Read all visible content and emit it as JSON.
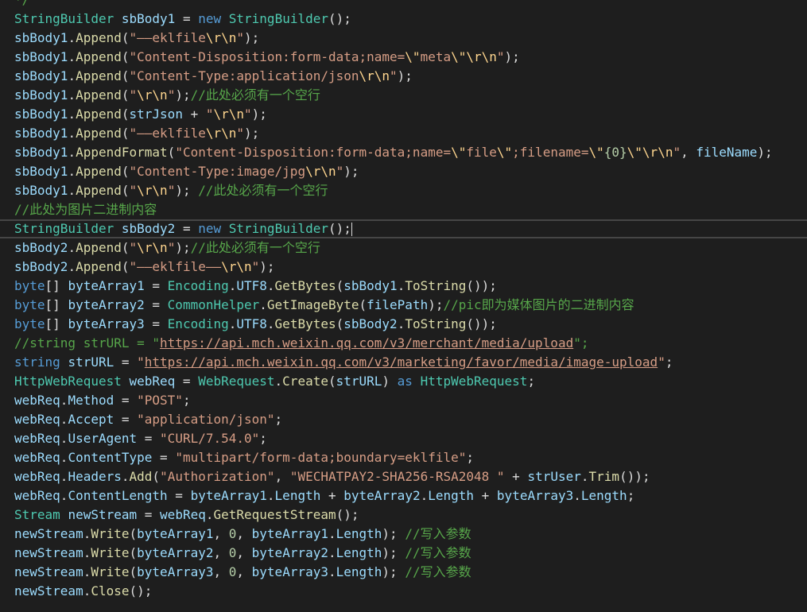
{
  "colors": {
    "background": "#1e1e1e",
    "plain": "#dcdcdc",
    "type": "#4ec9b0",
    "keyword": "#569cd6",
    "variable": "#9cdcfe",
    "string": "#d69d85",
    "escape": "#ffd68f",
    "comment": "#57a64a",
    "method": "#dcdcaa",
    "number": "#b5cea8"
  },
  "editor": {
    "current_line_index": 12,
    "lines": [
      [
        [
          "comment",
          "*/"
        ]
      ],
      [
        [
          "type",
          "StringBuilder"
        ],
        [
          "plain",
          " "
        ],
        [
          "var",
          "sbBody1"
        ],
        [
          "plain",
          " = "
        ],
        [
          "keyword",
          "new"
        ],
        [
          "plain",
          " "
        ],
        [
          "type",
          "StringBuilder"
        ],
        [
          "plain",
          "();"
        ]
      ],
      [
        [
          "var",
          "sbBody1"
        ],
        [
          "plain",
          "."
        ],
        [
          "method",
          "Append"
        ],
        [
          "plain",
          "("
        ],
        [
          "string",
          "\"——eklfile"
        ],
        [
          "escape",
          "\\r\\n"
        ],
        [
          "string",
          "\""
        ],
        [
          "plain",
          ");"
        ]
      ],
      [
        [
          "var",
          "sbBody1"
        ],
        [
          "plain",
          "."
        ],
        [
          "method",
          "Append"
        ],
        [
          "plain",
          "("
        ],
        [
          "string",
          "\"Content-Disposition:form-data;name="
        ],
        [
          "escape",
          "\\\""
        ],
        [
          "string",
          "meta"
        ],
        [
          "escape",
          "\\\"\\r\\n"
        ],
        [
          "string",
          "\""
        ],
        [
          "plain",
          ");"
        ]
      ],
      [
        [
          "var",
          "sbBody1"
        ],
        [
          "plain",
          "."
        ],
        [
          "method",
          "Append"
        ],
        [
          "plain",
          "("
        ],
        [
          "string",
          "\"Content-Type:application/json"
        ],
        [
          "escape",
          "\\r\\n"
        ],
        [
          "string",
          "\""
        ],
        [
          "plain",
          ");"
        ]
      ],
      [
        [
          "var",
          "sbBody1"
        ],
        [
          "plain",
          "."
        ],
        [
          "method",
          "Append"
        ],
        [
          "plain",
          "("
        ],
        [
          "string",
          "\""
        ],
        [
          "escape",
          "\\r\\n"
        ],
        [
          "string",
          "\""
        ],
        [
          "plain",
          ");"
        ],
        [
          "comment",
          "//此处必须有一个空行"
        ]
      ],
      [
        [
          "var",
          "sbBody1"
        ],
        [
          "plain",
          "."
        ],
        [
          "method",
          "Append"
        ],
        [
          "plain",
          "("
        ],
        [
          "var",
          "strJson"
        ],
        [
          "plain",
          " + "
        ],
        [
          "string",
          "\""
        ],
        [
          "escape",
          "\\r\\n"
        ],
        [
          "string",
          "\""
        ],
        [
          "plain",
          ");"
        ]
      ],
      [
        [
          "var",
          "sbBody1"
        ],
        [
          "plain",
          "."
        ],
        [
          "method",
          "Append"
        ],
        [
          "plain",
          "("
        ],
        [
          "string",
          "\"——eklfile"
        ],
        [
          "escape",
          "\\r\\n"
        ],
        [
          "string",
          "\""
        ],
        [
          "plain",
          ");"
        ]
      ],
      [
        [
          "var",
          "sbBody1"
        ],
        [
          "plain",
          "."
        ],
        [
          "method",
          "AppendFormat"
        ],
        [
          "plain",
          "("
        ],
        [
          "string",
          "\"Content-Disposition:form-data;name="
        ],
        [
          "escape",
          "\\\""
        ],
        [
          "string",
          "file"
        ],
        [
          "escape",
          "\\\""
        ],
        [
          "string",
          ";filename="
        ],
        [
          "escape",
          "\\\""
        ],
        [
          "number",
          "{0}"
        ],
        [
          "escape",
          "\\\"\\r\\n"
        ],
        [
          "string",
          "\""
        ],
        [
          "plain",
          ", "
        ],
        [
          "var",
          "fileName"
        ],
        [
          "plain",
          ");"
        ]
      ],
      [
        [
          "var",
          "sbBody1"
        ],
        [
          "plain",
          "."
        ],
        [
          "method",
          "Append"
        ],
        [
          "plain",
          "("
        ],
        [
          "string",
          "\"Content-Type:image/jpg"
        ],
        [
          "escape",
          "\\r\\n"
        ],
        [
          "string",
          "\""
        ],
        [
          "plain",
          ");"
        ]
      ],
      [
        [
          "var",
          "sbBody1"
        ],
        [
          "plain",
          "."
        ],
        [
          "method",
          "Append"
        ],
        [
          "plain",
          "("
        ],
        [
          "string",
          "\""
        ],
        [
          "escape",
          "\\r\\n"
        ],
        [
          "string",
          "\""
        ],
        [
          "plain",
          "); "
        ],
        [
          "comment",
          "//此处必须有一个空行"
        ]
      ],
      [
        [
          "comment",
          "//此处为图片二进制内容"
        ]
      ],
      [
        [
          "type",
          "StringBuilder"
        ],
        [
          "plain",
          " "
        ],
        [
          "var",
          "sbBody2"
        ],
        [
          "plain",
          " = "
        ],
        [
          "keyword",
          "new"
        ],
        [
          "plain",
          " "
        ],
        [
          "type",
          "StringBuilder"
        ],
        [
          "plain",
          "();"
        ]
      ],
      [
        [
          "var",
          "sbBody2"
        ],
        [
          "plain",
          "."
        ],
        [
          "method",
          "Append"
        ],
        [
          "plain",
          "("
        ],
        [
          "string",
          "\""
        ],
        [
          "escape",
          "\\r\\n"
        ],
        [
          "string",
          "\""
        ],
        [
          "plain",
          ");"
        ],
        [
          "comment",
          "//此处必须有一个空行"
        ]
      ],
      [
        [
          "var",
          "sbBody2"
        ],
        [
          "plain",
          "."
        ],
        [
          "method",
          "Append"
        ],
        [
          "plain",
          "("
        ],
        [
          "string",
          "\"——eklfile——"
        ],
        [
          "escape",
          "\\r\\n"
        ],
        [
          "string",
          "\""
        ],
        [
          "plain",
          ");"
        ]
      ],
      [
        [
          "keyword",
          "byte"
        ],
        [
          "plain",
          "[] "
        ],
        [
          "var",
          "byteArray1"
        ],
        [
          "plain",
          " = "
        ],
        [
          "type",
          "Encoding"
        ],
        [
          "plain",
          "."
        ],
        [
          "var",
          "UTF8"
        ],
        [
          "plain",
          "."
        ],
        [
          "method",
          "GetBytes"
        ],
        [
          "plain",
          "("
        ],
        [
          "var",
          "sbBody1"
        ],
        [
          "plain",
          "."
        ],
        [
          "method",
          "ToString"
        ],
        [
          "plain",
          "());"
        ]
      ],
      [
        [
          "keyword",
          "byte"
        ],
        [
          "plain",
          "[] "
        ],
        [
          "var",
          "byteArray2"
        ],
        [
          "plain",
          " = "
        ],
        [
          "type",
          "CommonHelper"
        ],
        [
          "plain",
          "."
        ],
        [
          "method",
          "GetImageByte"
        ],
        [
          "plain",
          "("
        ],
        [
          "var",
          "filePath"
        ],
        [
          "plain",
          ");"
        ],
        [
          "comment",
          "//pic即为媒体图片的二进制内容"
        ]
      ],
      [
        [
          "keyword",
          "byte"
        ],
        [
          "plain",
          "[] "
        ],
        [
          "var",
          "byteArray3"
        ],
        [
          "plain",
          " = "
        ],
        [
          "type",
          "Encoding"
        ],
        [
          "plain",
          "."
        ],
        [
          "var",
          "UTF8"
        ],
        [
          "plain",
          "."
        ],
        [
          "method",
          "GetBytes"
        ],
        [
          "plain",
          "("
        ],
        [
          "var",
          "sbBody2"
        ],
        [
          "plain",
          "."
        ],
        [
          "method",
          "ToString"
        ],
        [
          "plain",
          "());"
        ]
      ],
      [
        [
          "comment",
          "//string strURL = \""
        ],
        [
          "link",
          "https://api.mch.weixin.qq.com/v3/merchant/media/upload"
        ],
        [
          "comment",
          "\";"
        ]
      ],
      [
        [
          "keyword",
          "string"
        ],
        [
          "plain",
          " "
        ],
        [
          "var",
          "strURL"
        ],
        [
          "plain",
          " = "
        ],
        [
          "string",
          "\""
        ],
        [
          "link",
          "https://api.mch.weixin.qq.com/v3/marketing/favor/media/image-upload"
        ],
        [
          "string",
          "\""
        ],
        [
          "plain",
          ";"
        ]
      ],
      [
        [
          "type",
          "HttpWebRequest"
        ],
        [
          "plain",
          " "
        ],
        [
          "var",
          "webReq"
        ],
        [
          "plain",
          " = "
        ],
        [
          "type",
          "WebRequest"
        ],
        [
          "plain",
          "."
        ],
        [
          "method",
          "Create"
        ],
        [
          "plain",
          "("
        ],
        [
          "var",
          "strURL"
        ],
        [
          "plain",
          ") "
        ],
        [
          "keyword",
          "as"
        ],
        [
          "plain",
          " "
        ],
        [
          "type",
          "HttpWebRequest"
        ],
        [
          "plain",
          ";"
        ]
      ],
      [
        [
          "var",
          "webReq"
        ],
        [
          "plain",
          "."
        ],
        [
          "var",
          "Method"
        ],
        [
          "plain",
          " = "
        ],
        [
          "string",
          "\"POST\""
        ],
        [
          "plain",
          ";"
        ]
      ],
      [
        [
          "var",
          "webReq"
        ],
        [
          "plain",
          "."
        ],
        [
          "var",
          "Accept"
        ],
        [
          "plain",
          " = "
        ],
        [
          "string",
          "\"application/json\""
        ],
        [
          "plain",
          ";"
        ]
      ],
      [
        [
          "var",
          "webReq"
        ],
        [
          "plain",
          "."
        ],
        [
          "var",
          "UserAgent"
        ],
        [
          "plain",
          " = "
        ],
        [
          "string",
          "\"CURL/7.54.0\""
        ],
        [
          "plain",
          ";"
        ]
      ],
      [
        [
          "var",
          "webReq"
        ],
        [
          "plain",
          "."
        ],
        [
          "var",
          "ContentType"
        ],
        [
          "plain",
          " = "
        ],
        [
          "string",
          "\"multipart/form-data;boundary=eklfile\""
        ],
        [
          "plain",
          ";"
        ]
      ],
      [
        [
          "var",
          "webReq"
        ],
        [
          "plain",
          "."
        ],
        [
          "var",
          "Headers"
        ],
        [
          "plain",
          "."
        ],
        [
          "method",
          "Add"
        ],
        [
          "plain",
          "("
        ],
        [
          "string",
          "\"Authorization\""
        ],
        [
          "plain",
          ", "
        ],
        [
          "string",
          "\"WECHATPAY2-SHA256-RSA2048 \""
        ],
        [
          "plain",
          " + "
        ],
        [
          "var",
          "strUser"
        ],
        [
          "plain",
          "."
        ],
        [
          "method",
          "Trim"
        ],
        [
          "plain",
          "());"
        ]
      ],
      [
        [
          "var",
          "webReq"
        ],
        [
          "plain",
          "."
        ],
        [
          "var",
          "ContentLength"
        ],
        [
          "plain",
          " = "
        ],
        [
          "var",
          "byteArray1"
        ],
        [
          "plain",
          "."
        ],
        [
          "var",
          "Length"
        ],
        [
          "plain",
          " + "
        ],
        [
          "var",
          "byteArray2"
        ],
        [
          "plain",
          "."
        ],
        [
          "var",
          "Length"
        ],
        [
          "plain",
          " + "
        ],
        [
          "var",
          "byteArray3"
        ],
        [
          "plain",
          "."
        ],
        [
          "var",
          "Length"
        ],
        [
          "plain",
          ";"
        ]
      ],
      [
        [
          "type",
          "Stream"
        ],
        [
          "plain",
          " "
        ],
        [
          "var",
          "newStream"
        ],
        [
          "plain",
          " = "
        ],
        [
          "var",
          "webReq"
        ],
        [
          "plain",
          "."
        ],
        [
          "method",
          "GetRequestStream"
        ],
        [
          "plain",
          "();"
        ]
      ],
      [
        [
          "var",
          "newStream"
        ],
        [
          "plain",
          "."
        ],
        [
          "method",
          "Write"
        ],
        [
          "plain",
          "("
        ],
        [
          "var",
          "byteArray1"
        ],
        [
          "plain",
          ", "
        ],
        [
          "number",
          "0"
        ],
        [
          "plain",
          ", "
        ],
        [
          "var",
          "byteArray1"
        ],
        [
          "plain",
          "."
        ],
        [
          "var",
          "Length"
        ],
        [
          "plain",
          "); "
        ],
        [
          "comment",
          "//写入参数"
        ]
      ],
      [
        [
          "var",
          "newStream"
        ],
        [
          "plain",
          "."
        ],
        [
          "method",
          "Write"
        ],
        [
          "plain",
          "("
        ],
        [
          "var",
          "byteArray2"
        ],
        [
          "plain",
          ", "
        ],
        [
          "number",
          "0"
        ],
        [
          "plain",
          ", "
        ],
        [
          "var",
          "byteArray2"
        ],
        [
          "plain",
          "."
        ],
        [
          "var",
          "Length"
        ],
        [
          "plain",
          "); "
        ],
        [
          "comment",
          "//写入参数"
        ]
      ],
      [
        [
          "var",
          "newStream"
        ],
        [
          "plain",
          "."
        ],
        [
          "method",
          "Write"
        ],
        [
          "plain",
          "("
        ],
        [
          "var",
          "byteArray3"
        ],
        [
          "plain",
          ", "
        ],
        [
          "number",
          "0"
        ],
        [
          "plain",
          ", "
        ],
        [
          "var",
          "byteArray3"
        ],
        [
          "plain",
          "."
        ],
        [
          "var",
          "Length"
        ],
        [
          "plain",
          "); "
        ],
        [
          "comment",
          "//写入参数"
        ]
      ],
      [
        [
          "var",
          "newStream"
        ],
        [
          "plain",
          "."
        ],
        [
          "method",
          "Close"
        ],
        [
          "plain",
          "();"
        ]
      ]
    ]
  }
}
